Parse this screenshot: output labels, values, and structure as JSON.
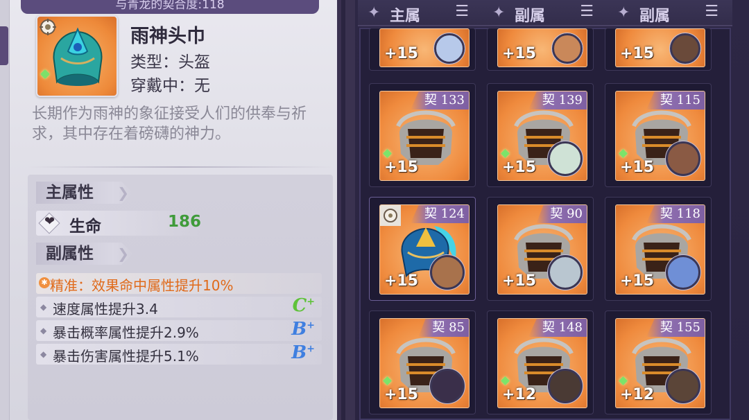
{
  "top_banner": {
    "text": "与青龙的契合度:118"
  },
  "item": {
    "name": "雨神头巾",
    "type_line": "类型：头盔",
    "wearer_line": "穿戴中：无",
    "description": "长期作为雨神的象征接受人们的供奉与祈求，其中存在着磅礴的神力。"
  },
  "main_attr": {
    "header": "主属性",
    "stat_name": "生命",
    "stat_value": "186"
  },
  "sub_attr": {
    "header": "副属性",
    "rows": [
      {
        "text": "精准：效果命中属性提升10%",
        "grade": "",
        "highlight": true
      },
      {
        "text": "速度属性提升3.4",
        "grade": "C",
        "grade_color": "#5fc23a"
      },
      {
        "text": "暴击概率属性提升2.9%",
        "grade": "B",
        "grade_color": "#3f7fe0"
      },
      {
        "text": "暴击伤害属性提升5.1%",
        "grade": "B",
        "grade_color": "#3f7fe0"
      }
    ]
  },
  "tabs": [
    {
      "label": "主属",
      "sort_icon": "sort-icon"
    },
    {
      "label": "副属",
      "sort_icon": "sort-icon"
    },
    {
      "label": "副属",
      "sort_icon": "sort-icon"
    }
  ],
  "grid": {
    "top_row": [
      {
        "enhance": "+15",
        "avatar_color": "#b7c9ea"
      },
      {
        "enhance": "+15",
        "avatar_color": "#c9885a"
      },
      {
        "enhance": "+15",
        "avatar_color": "#6a4a3a"
      }
    ],
    "rows": [
      [
        {
          "pact": "契 133",
          "enhance": "+15",
          "avatar": false,
          "avatar_color": ""
        },
        {
          "pact": "契 139",
          "enhance": "+15",
          "avatar": true,
          "avatar_color": "#cfe2d6"
        },
        {
          "pact": "契 115",
          "enhance": "+15",
          "avatar": true,
          "avatar_color": "#8a5a44"
        }
      ],
      [
        {
          "pact": "契 124",
          "enhance": "+15",
          "avatar": true,
          "avatar_color": "#a8724c",
          "selected": true
        },
        {
          "pact": "契 90",
          "enhance": "+15",
          "avatar": true,
          "avatar_color": "#b9c6d0"
        },
        {
          "pact": "契 118",
          "enhance": "+15",
          "avatar": true,
          "avatar_color": "#6f8fd6"
        }
      ],
      [
        {
          "pact": "契 85",
          "enhance": "+15",
          "avatar": true,
          "avatar_color": "#3a2f4a"
        },
        {
          "pact": "契 148",
          "enhance": "+12",
          "avatar": true,
          "avatar_color": "#4a3a34"
        },
        {
          "pact": "契 155",
          "enhance": "+12",
          "avatar": true,
          "avatar_color": "#5b4538"
        }
      ]
    ]
  },
  "colors": {
    "accent_purple": "#5b4c7d",
    "card_orange": "#ef8a3d",
    "hp_green": "#3f9b3a",
    "highlight_orange": "#e06a1a"
  }
}
